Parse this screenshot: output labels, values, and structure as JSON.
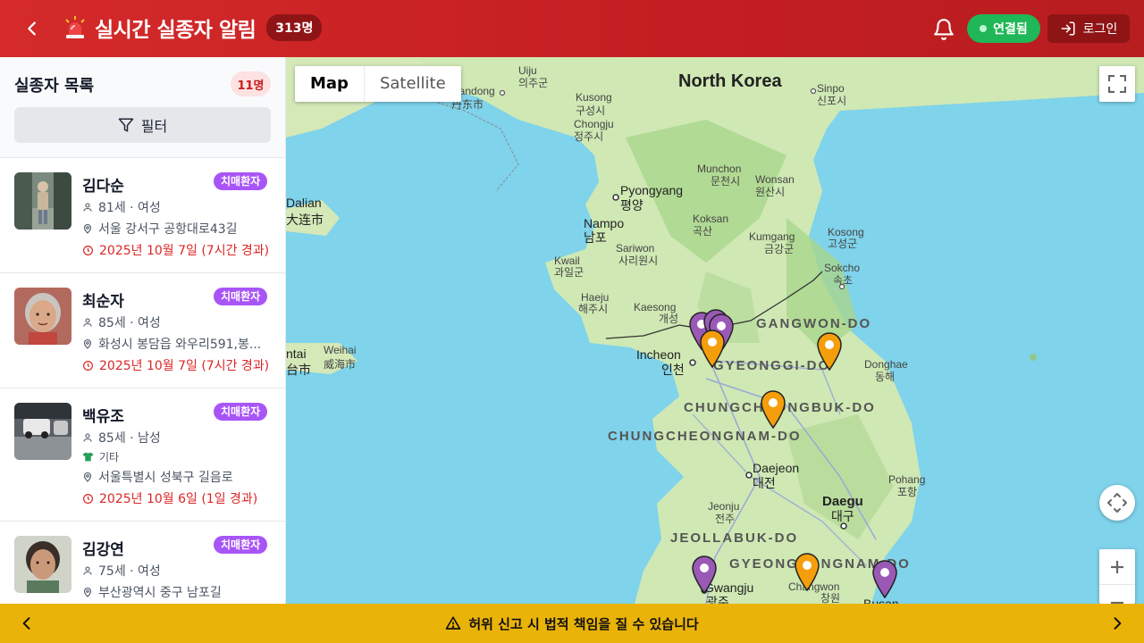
{
  "header": {
    "title": "실시간 실종자 알림",
    "total_badge": "313명",
    "connection_label": "연결됨",
    "login_label": "로그인",
    "accent_color": "#d42a2a"
  },
  "sidebar": {
    "title": "실종자 목록",
    "count": "11명",
    "filter_label": "필터",
    "items": [
      {
        "name": "김다순",
        "tag": "치매환자",
        "age_gender": "81세 · 여성",
        "location": "서울 강서구 공항대로43길",
        "time": "2025년 10월 7일 (7시간 경과)"
      },
      {
        "name": "최순자",
        "tag": "치매환자",
        "age_gender": "85세 · 여성",
        "location": "화성시 봉담읍 와우리591,봉...",
        "time": "2025년 10월 7일 (7시간 경과)"
      },
      {
        "name": "백유조",
        "tag": "치매환자",
        "age_gender": "85세 · 남성",
        "clothing": "기타",
        "location": "서울특별시 성북구 길음로",
        "time": "2025년 10월 6일 (1일 경과)"
      },
      {
        "name": "김강연",
        "tag": "치매환자",
        "age_gender": "75세 · 여성",
        "location": "부산광역시 중구 남포길"
      }
    ]
  },
  "map": {
    "toggle": {
      "map": "Map",
      "satellite": "Satellite"
    },
    "labels": {
      "north_korea": "North Korea",
      "uiju": "Uiju",
      "uiju_ko": "의주군",
      "dandong": "Dandong",
      "dandong_cn": "丹东市",
      "kusong": "Kusong",
      "kusong_ko": "구성시",
      "chongju": "Chongju",
      "chongju_ko": "정주시",
      "sinpo": "Sinpo",
      "sinpo_ko": "신포시",
      "munchon": "Munchon",
      "munchon_ko": "문천시",
      "wonsan": "Wonsan",
      "wonsan_ko": "원산시",
      "pyongyang": "Pyongyang",
      "pyongyang_ko": "평양",
      "nampo": "Nampo",
      "nampo_ko": "남포",
      "koksan": "Koksan",
      "koksan_ko": "곡산",
      "kosong": "Kosong",
      "kosong_ko": "고성군",
      "dalian": "Dalian",
      "dalian_cn": "大连市",
      "sariwon": "Sariwon",
      "sariwon_ko": "사리원시",
      "kumgang": "Kumgang",
      "kumgang_ko": "금강군",
      "kwail": "Kwail",
      "kwail_ko": "과일군",
      "sokcho": "Sokcho",
      "sokcho_ko": "속초",
      "haeju": "Haeju",
      "haeju_ko": "해주시",
      "kaesong": "Kaesong",
      "kaesong_ko": "개성",
      "gangwon": "GANGWON-DO",
      "yantai": "ntai",
      "yantai_cn": "台市",
      "weihai": "Weihai",
      "weihai_cn": "威海市",
      "incheon": "Incheon",
      "incheon_ko": "인천",
      "gyeonggi": "GYEONGGI-DO",
      "donghae": "Donghae",
      "donghae_ko": "동해",
      "chungbuk": "CHUNGCHEONGBUK-DO",
      "chungnam": "CHUNGCHEONGNAM-DO",
      "daejeon": "Daejeon",
      "daejeon_ko": "대전",
      "pohang": "Pohang",
      "pohang_ko": "포항",
      "daegu": "Daegu",
      "daegu_ko": "대구",
      "jeonju": "Jeonju",
      "jeonju_ko": "전주",
      "jeonbuk": "JEOLLABUK-DO",
      "gyeongnam": "GYEONGSANGNAM-DO",
      "gwangju": "Gwangju",
      "gwangju_ko": "광주",
      "changwon": "Changwon",
      "changwon_ko": "창원",
      "busan": "Busan"
    }
  },
  "footer": {
    "warning": "허위 신고 시 법적 책임을 질 수 있습니다"
  },
  "colors": {
    "tag_purple": "#a855f7",
    "pin_orange": "#f59e0b",
    "pin_purple": "#9b59b6",
    "footer_yellow": "#eab308",
    "connected_green": "#1fb757"
  }
}
